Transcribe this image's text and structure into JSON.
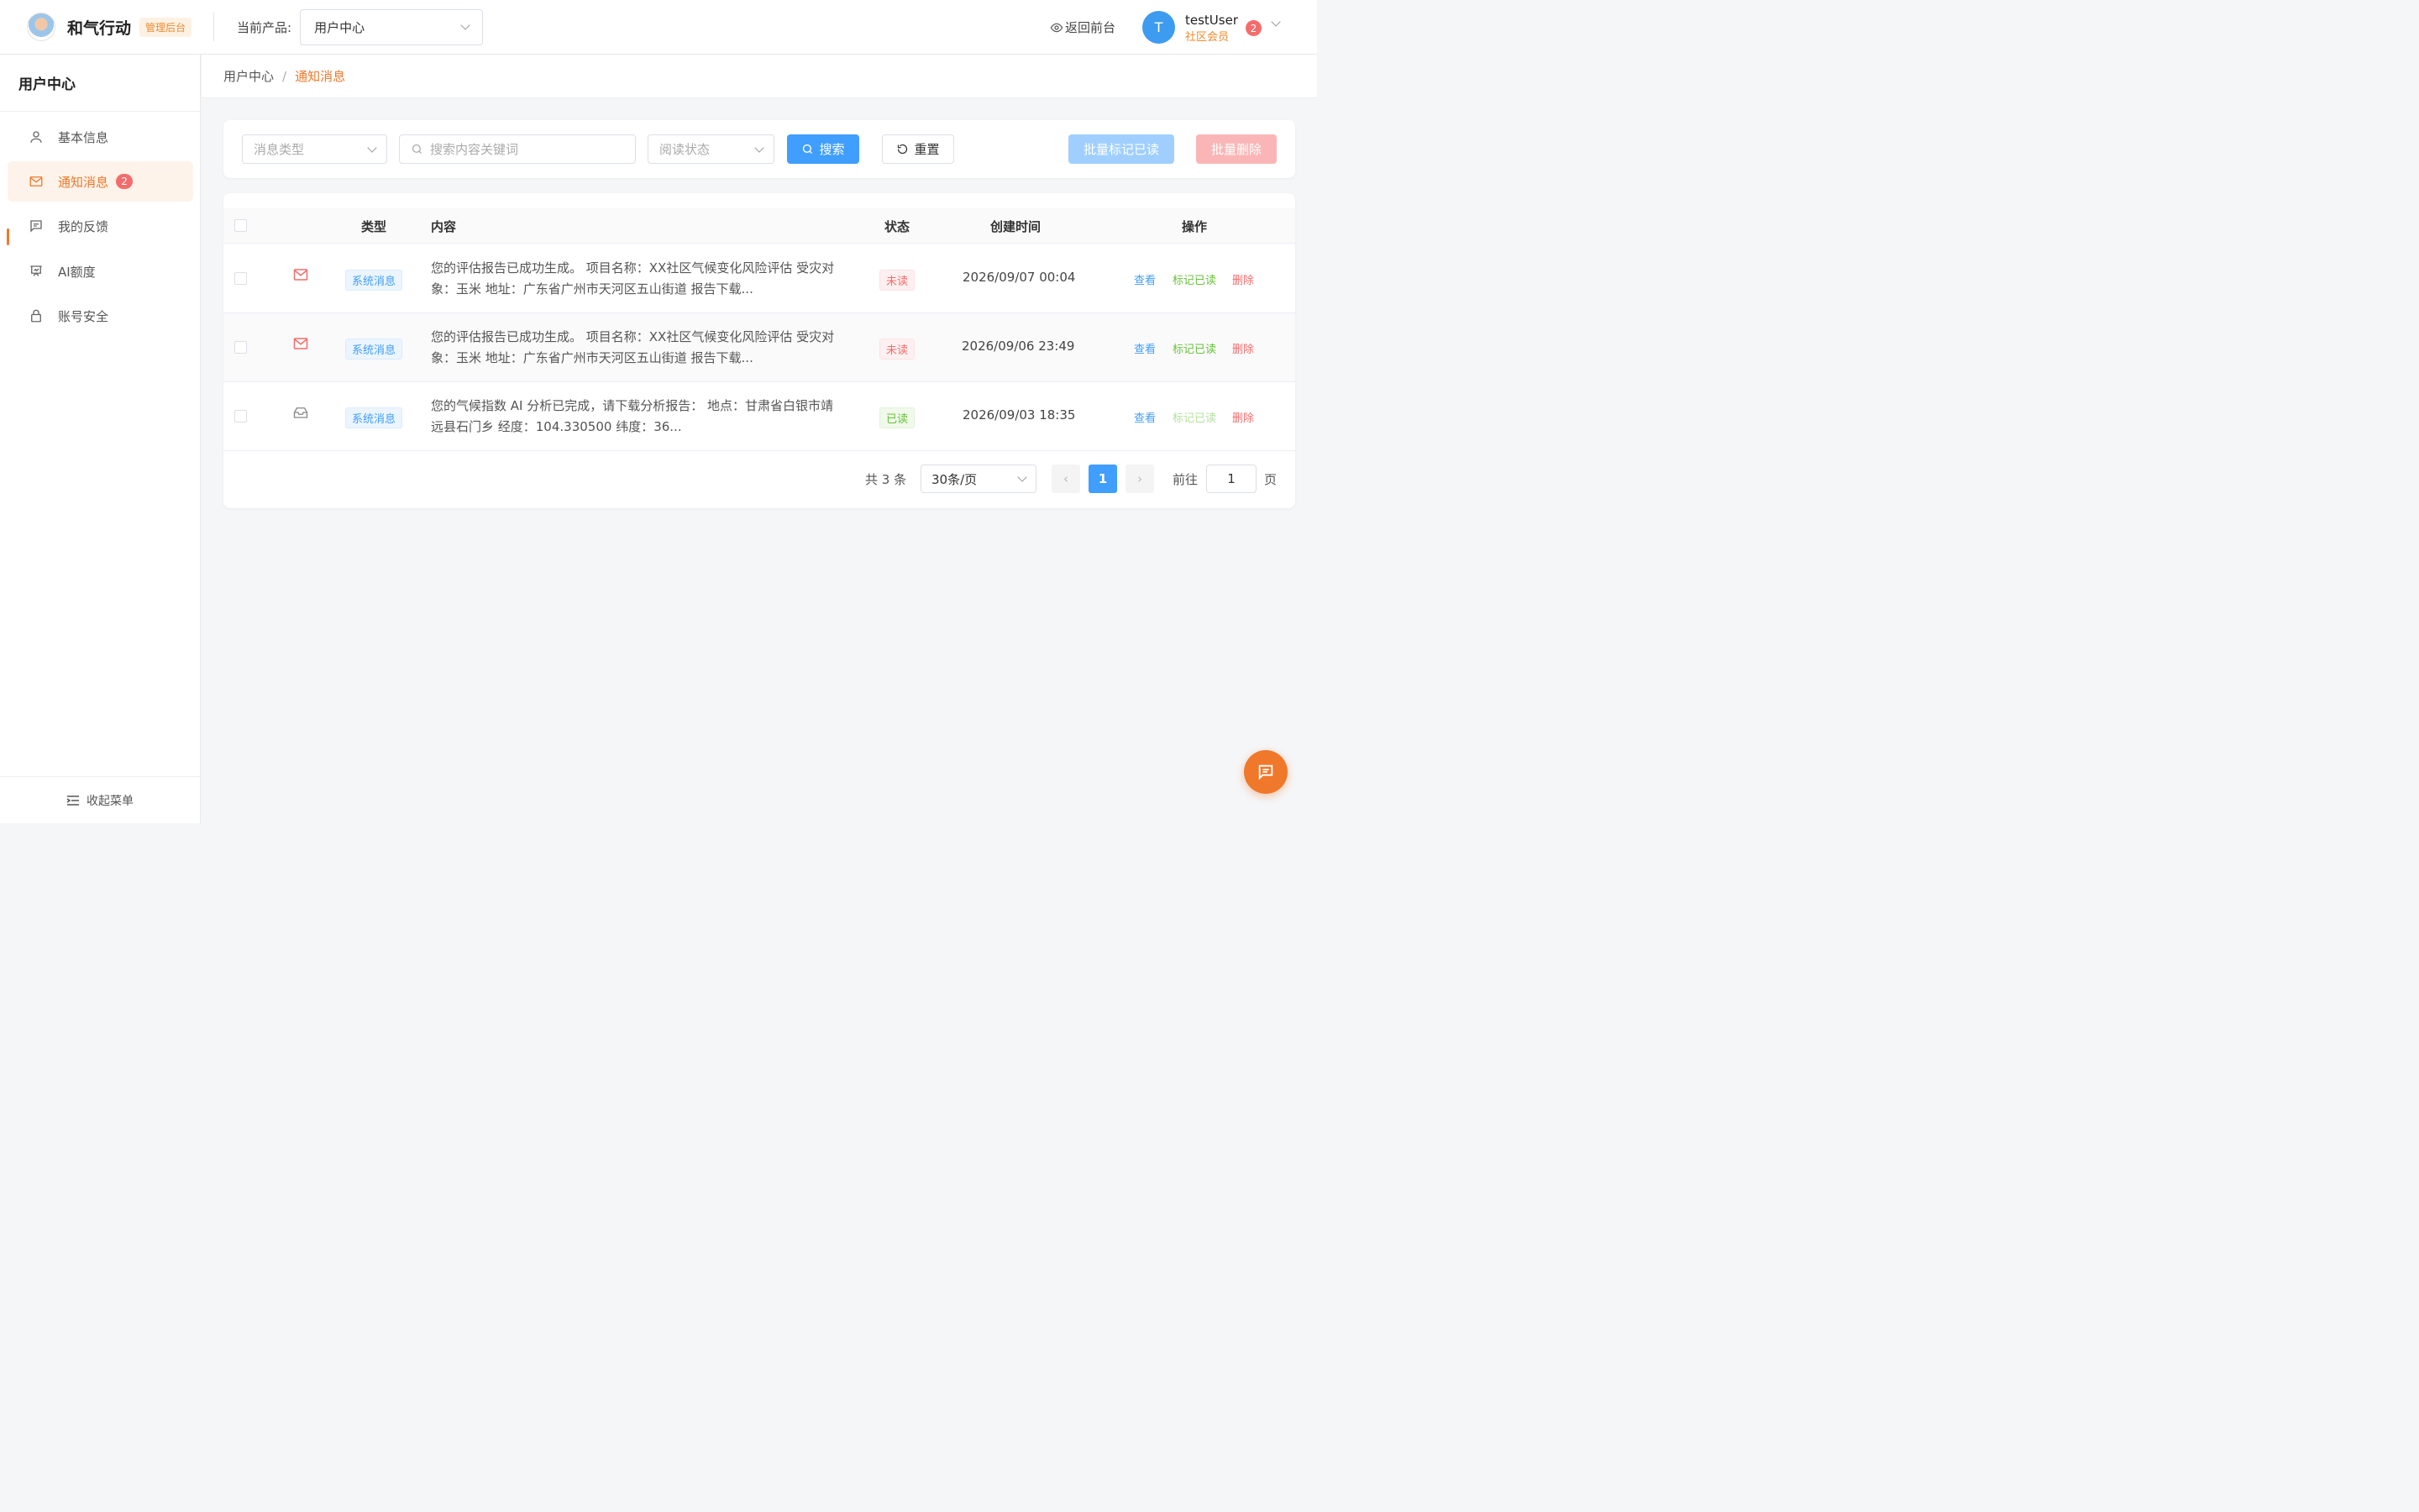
{
  "header": {
    "brand": "和气行动",
    "admin_tag": "管理后台",
    "product_label": "当前产品:",
    "product_value": "用户中心",
    "back_front": "返回前台",
    "user": {
      "avatar_letter": "T",
      "name": "testUser",
      "role": "社区会员",
      "badge": "2"
    }
  },
  "sidebar": {
    "title": "用户中心",
    "items": [
      {
        "label": "基本信息",
        "icon": "user-icon"
      },
      {
        "label": "通知消息",
        "icon": "mail-icon",
        "badge": "2",
        "active": true
      },
      {
        "label": "我的反馈",
        "icon": "feedback-icon"
      },
      {
        "label": "AI额度",
        "icon": "chart-board-icon"
      },
      {
        "label": "账号安全",
        "icon": "lock-icon"
      }
    ],
    "collapse_label": "收起菜单"
  },
  "breadcrumb": {
    "parent": "用户中心",
    "sep": "/",
    "current": "通知消息"
  },
  "filters": {
    "type_placeholder": "消息类型",
    "keyword_placeholder": "搜索内容关键词",
    "status_placeholder": "阅读状态",
    "search_label": "搜索",
    "reset_label": "重置",
    "batch_read_label": "批量标记已读",
    "batch_delete_label": "批量删除"
  },
  "table": {
    "headers": {
      "type": "类型",
      "content": "内容",
      "status": "状态",
      "created": "创建时间",
      "ops": "操作"
    },
    "rows": [
      {
        "icon": "mail-icon",
        "type": "系统消息",
        "content": "您的评估报告已成功生成。 项目名称：XX社区气候变化风险评估 受灾对象：玉米 地址：广东省广州市天河区五山街道 报告下载...",
        "status": "未读",
        "created": "2026/09/07 00:04",
        "view": "查看",
        "mark": "标记已读",
        "delete": "删除"
      },
      {
        "icon": "mail-icon",
        "type": "系统消息",
        "content": "您的评估报告已成功生成。 项目名称：XX社区气候变化风险评估 受灾对象：玉米 地址：广东省广州市天河区五山街道 报告下载...",
        "status": "未读",
        "created": "2026/09/06 23:49",
        "view": "查看",
        "mark": "标记已读",
        "delete": "删除"
      },
      {
        "icon": "open-mail-icon",
        "type": "系统消息",
        "content": "您的气候指数 AI 分析已完成，请下载分析报告： 地点：甘肃省白银市靖远县石门乡 经度：104.330500 纬度：36...",
        "status": "已读",
        "created": "2026/09/03 18:35",
        "view": "查看",
        "mark": "标记已读",
        "delete": "删除"
      }
    ]
  },
  "pagination": {
    "total": "共 3 条",
    "page_size": "30条/页",
    "current_page": "1",
    "goto_label": "前往",
    "goto_value": "1",
    "page_suffix": "页"
  },
  "colors": {
    "accent": "#f0782a",
    "primary": "#409eff",
    "danger": "#f56c6c",
    "success": "#67c23a"
  }
}
